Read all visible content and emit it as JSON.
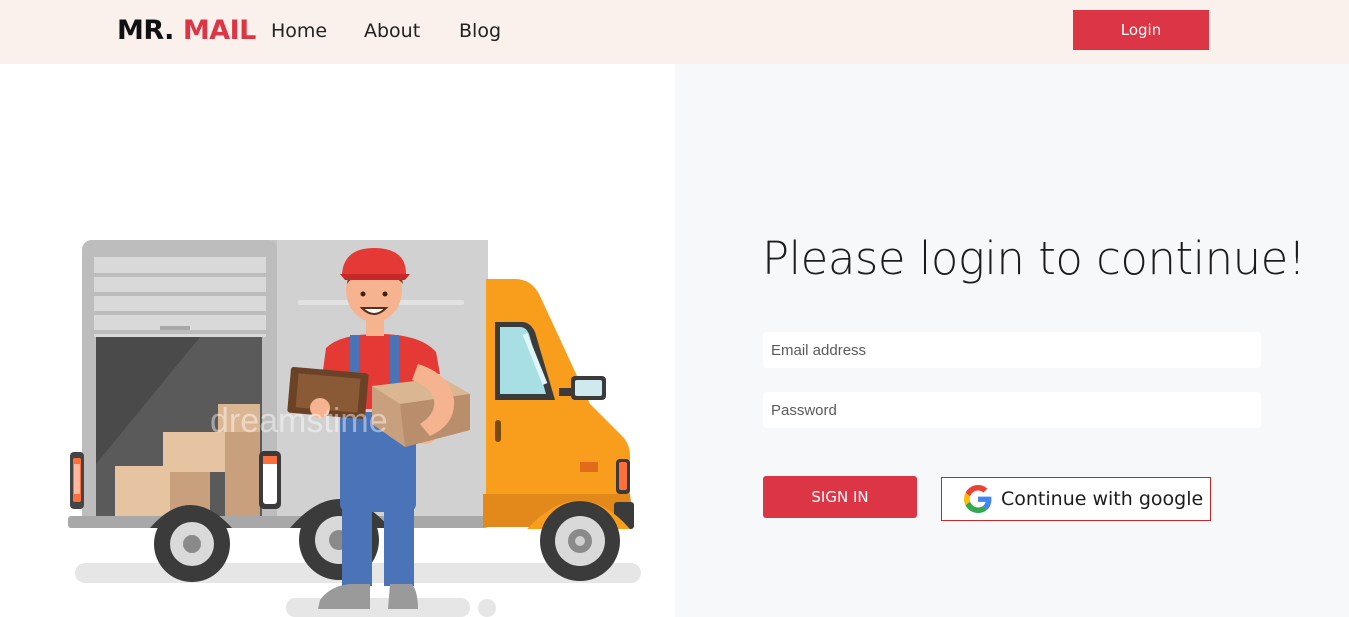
{
  "navbar": {
    "brand_part1": "MR.",
    "brand_part2": "MAIL",
    "links": [
      "Home",
      "About",
      "Blog"
    ],
    "login_label": "Login"
  },
  "hero": {
    "illustration": "delivery-man-with-van",
    "watermark": "dreamstime"
  },
  "login": {
    "heading": "Please login to continue!",
    "email_placeholder": "Email address",
    "password_placeholder": "Password",
    "signin_label": "SIGN IN",
    "google_label": "Continue with google"
  },
  "colors": {
    "accent": "#dc3545",
    "navbar_bg": "#faf1ec",
    "panel_bg": "#f7f8fa",
    "van_orange": "#f99d1c"
  }
}
